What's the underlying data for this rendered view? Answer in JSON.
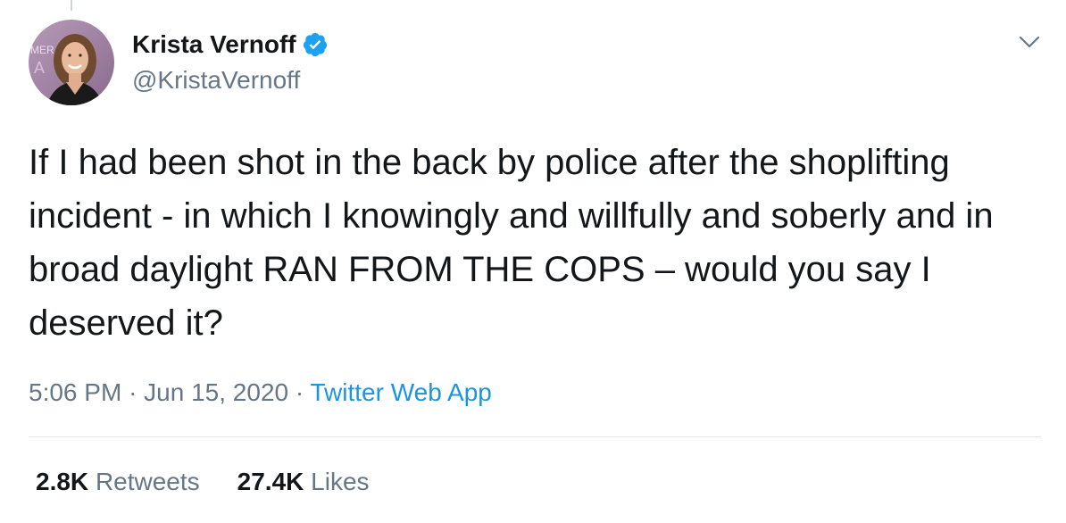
{
  "tweet": {
    "author": {
      "display_name": "Krista Vernoff",
      "handle": "@KristaVernoff",
      "verified": true,
      "avatar_backdrop_text": "MER"
    },
    "text": "If I had been shot in the back by police after the shoplifting incident - in which I knowingly and willfully and soberly and in broad daylight RAN FROM THE COPS – would you say I deserved it?",
    "timestamp": {
      "time": "5:06 PM",
      "separator": "·",
      "date": "Jun 15, 2020",
      "source": "Twitter Web App"
    },
    "stats": {
      "retweets_count": "2.8K",
      "retweets_label": "Retweets",
      "likes_count": "27.4K",
      "likes_label": "Likes"
    }
  },
  "icons": {
    "verified": "verified-badge-icon",
    "more": "chevron-down-icon"
  },
  "colors": {
    "text_primary": "#14171a",
    "text_secondary": "#657786",
    "link": "#1b95e0",
    "verified_blue": "#1da1f2",
    "divider": "#e1e8ed"
  }
}
